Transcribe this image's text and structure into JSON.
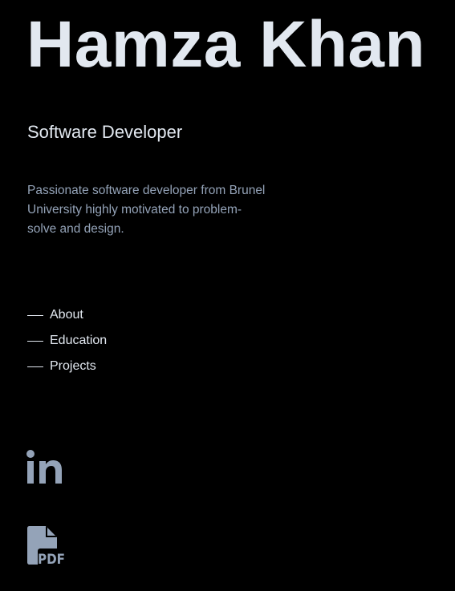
{
  "header": {
    "name": "Hamza Khan",
    "role": "Software Developer",
    "bio": "Passionate software developer from Brunel University highly motivated to problem-solve and design."
  },
  "nav": {
    "items": [
      {
        "label": "About"
      },
      {
        "label": "Education"
      },
      {
        "label": "Projects"
      }
    ]
  },
  "social": {
    "links": [
      {
        "icon": "linkedin-icon"
      },
      {
        "icon": "pdf-file-icon",
        "label": "PDF"
      }
    ]
  },
  "colors": {
    "background": "#000000",
    "heading": "#e2e8f0",
    "body_text": "#94a3b8",
    "icon": "#94a3b8"
  }
}
